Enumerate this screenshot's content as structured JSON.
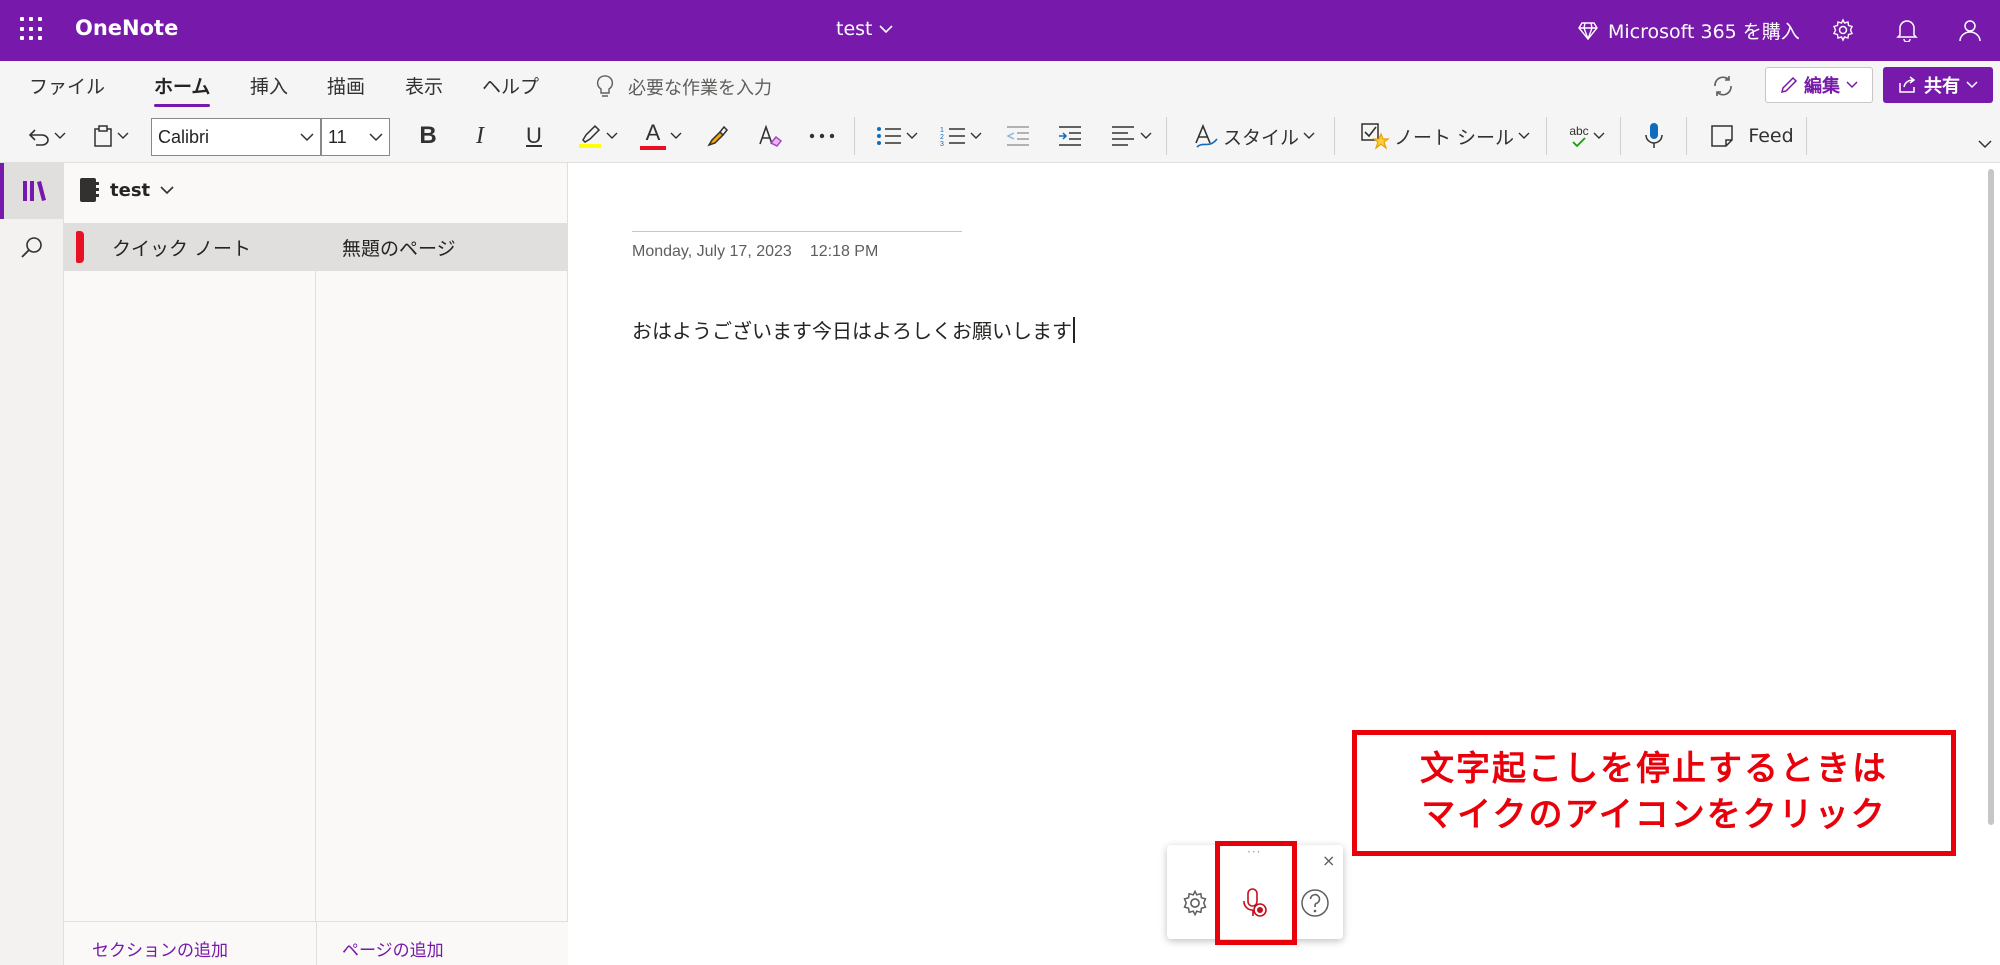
{
  "titlebar": {
    "app_name": "OneNote",
    "doc_title": "test",
    "buy_label": "Microsoft 365 を購入"
  },
  "menu": {
    "tabs": [
      {
        "label": "ファイル"
      },
      {
        "label": "ホーム"
      },
      {
        "label": "挿入"
      },
      {
        "label": "描画"
      },
      {
        "label": "表示"
      },
      {
        "label": "ヘルプ"
      }
    ],
    "active_tab": "ホーム",
    "tell_me_placeholder": "必要な作業を入力",
    "edit_label": "編集",
    "share_label": "共有"
  },
  "ribbon": {
    "font_name": "Calibri",
    "font_size": "11",
    "bold_label": "B",
    "italic_label": "I",
    "underline_label": "U",
    "font_color_label": "A",
    "styles_label": "スタイル",
    "tags_label": "ノート シール",
    "spelling_label": "abc",
    "feed_label": "Feed",
    "highlight_color": "#ffff00",
    "font_color": "#e81123"
  },
  "notebook": {
    "name": "test",
    "sections": [
      {
        "label": "クイック ノート",
        "color": "#e81123"
      }
    ],
    "pages": [
      {
        "label": "無題のページ"
      }
    ],
    "add_section_label": "セクションの追加",
    "add_page_label": "ページの追加"
  },
  "page": {
    "date": "Monday, July 17, 2023",
    "time": "12:18 PM",
    "body_text": "おはようございます今日はよろしくお願いします"
  },
  "dictation": {
    "grip": "···",
    "close_label": "×"
  },
  "annotation": {
    "line1": "文字起こしを停止するときは",
    "line2": "マイクのアイコンをクリック",
    "color": "#e8000b"
  },
  "colors": {
    "brand": "#7719aa"
  }
}
